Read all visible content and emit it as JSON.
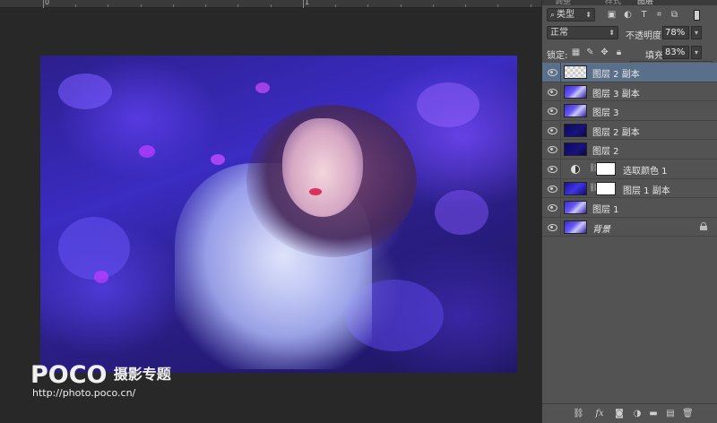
{
  "ruler": {
    "labels": [
      "0",
      "1"
    ]
  },
  "watermark": {
    "brand": "POCO",
    "tagline": "摄影专题",
    "url": "http://photo.poco.cn/"
  },
  "panel": {
    "tab_labels": [
      "调整",
      "样式",
      "图层"
    ],
    "filter": {
      "kind_label": "类型",
      "icons": [
        "image-filter-icon",
        "adjustment-filter-icon",
        "type-filter-icon",
        "shape-filter-icon",
        "smart-object-filter-icon"
      ]
    },
    "blend": {
      "mode": "正常",
      "opacity_label": "不透明度:",
      "opacity_value": "78%"
    },
    "lock": {
      "label": "锁定:",
      "fill_label": "填充:",
      "fill_value": "83%",
      "fill_level": 0.83
    },
    "layers": [
      {
        "name": "图层 2 副本",
        "thumb": "checker",
        "selected": true
      },
      {
        "name": "图层 3 副本",
        "thumb": "photo"
      },
      {
        "name": "图层 3",
        "thumb": "photo"
      },
      {
        "name": "图层 2 副本",
        "thumb": "dark"
      },
      {
        "name": "图层 2",
        "thumb": "dark"
      },
      {
        "name": "选取颜色 1",
        "thumb": "adj",
        "mask": true
      },
      {
        "name": "图层 1 副本",
        "thumb": "masksrc",
        "mask": true
      },
      {
        "name": "图层 1",
        "thumb": "photo"
      },
      {
        "name": "背景",
        "thumb": "photo",
        "locked": true
      }
    ],
    "bottom_icons": [
      "link-layers-icon",
      "fx-icon",
      "add-mask-icon",
      "new-fill-layer-icon",
      "new-group-icon",
      "new-layer-icon",
      "trash-icon"
    ]
  }
}
